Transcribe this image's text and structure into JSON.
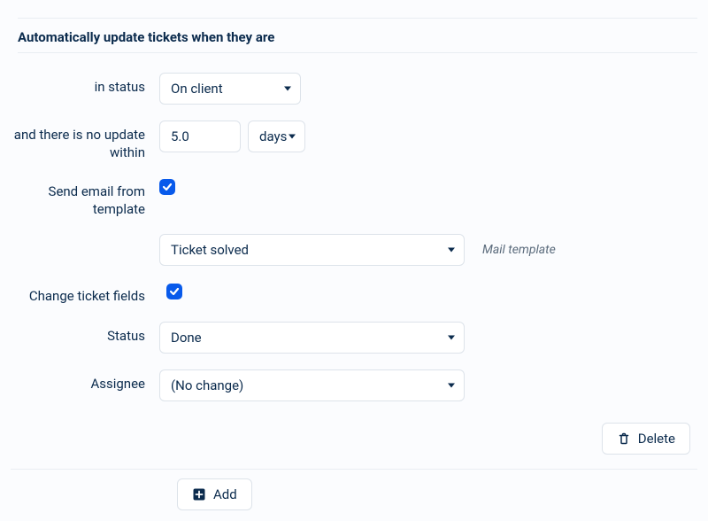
{
  "header": "Automatically update tickets when they are",
  "labels": {
    "in_status": "in status",
    "no_update": "and there is no update within",
    "send_email": "Send email from template",
    "change_fields": "Change ticket fields",
    "status": "Status",
    "assignee": "Assignee"
  },
  "values": {
    "in_status": "On client",
    "no_update_value": "5.0",
    "no_update_unit": "days",
    "mail_template": "Ticket solved",
    "status": "Done",
    "assignee": "(No change)"
  },
  "hints": {
    "mail_template": "Mail template"
  },
  "buttons": {
    "delete": "Delete",
    "add": "Add"
  }
}
